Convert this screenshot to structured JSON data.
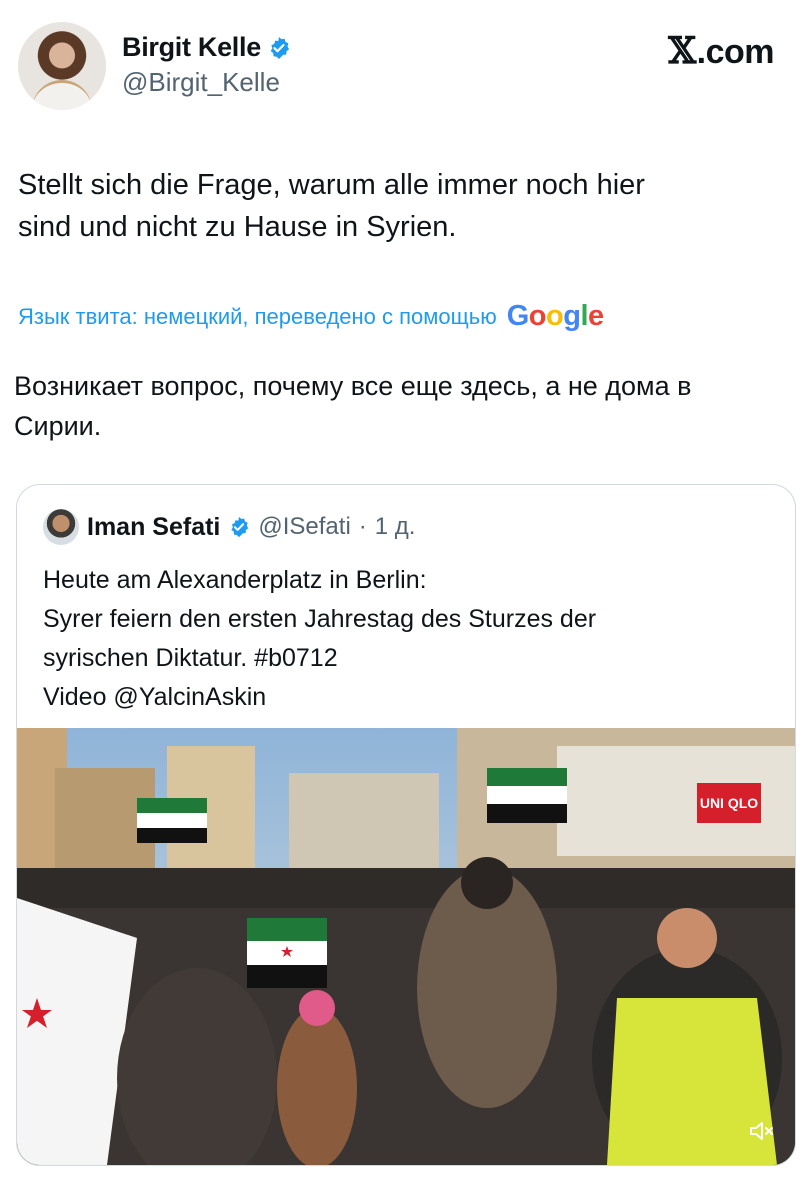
{
  "site": {
    "logo": "𝕏",
    "domain": ".com"
  },
  "author": {
    "name": "Birgit Kelle",
    "handle": "@Birgit_Kelle",
    "verified": true
  },
  "tweet": {
    "text": "Stellt sich die Frage, warum alle immer noch hier\nsind und nicht zu Hause in Syrien.",
    "translate_label": "Язык твита: немецкий, переведено с помощью",
    "translate_brand": [
      "G",
      "o",
      "o",
      "g",
      "l",
      "e"
    ],
    "translation": "Возникает вопрос, почему все еще здесь, а не дома в\nСирии."
  },
  "quote": {
    "name": "Iman Sefati",
    "verified": true,
    "handle": "@ISefati",
    "separator": "·",
    "time": "1 д.",
    "text": "Heute am Alexanderplatz in Berlin:\nSyrer feiern den ersten Jahrestag des Sturzes der\nsyrischen Diktatur. #b0712\nVideo @YalcinAskin",
    "media": {
      "type": "video",
      "shop_sign": "UNI QLO",
      "mute_icon": "speaker-muted-icon"
    }
  },
  "colors": {
    "accent": "#1d9bf0",
    "text": "#0f1419",
    "muted": "#536471",
    "border": "#cfd9de"
  }
}
